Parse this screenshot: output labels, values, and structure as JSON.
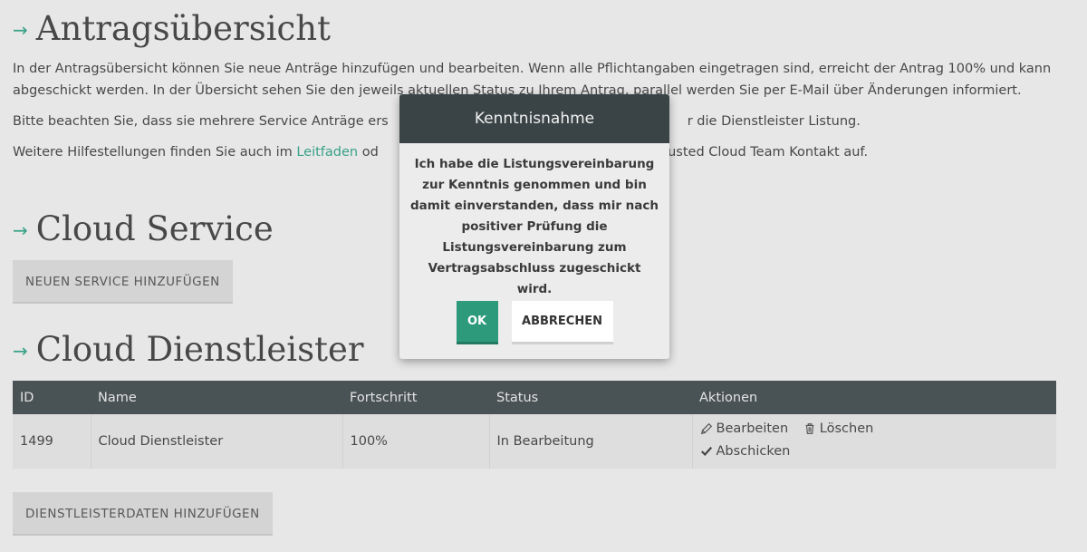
{
  "sections": {
    "overview_title": "Antragsübersicht",
    "cloud_service_title": "Cloud Service",
    "provider_title": "Cloud Dienstleister",
    "arrow": "→"
  },
  "intro": {
    "p1": "In der Antragsübersicht können Sie neue Anträge hinzufügen und bearbeiten. Wenn alle Pflichtangaben eingetragen sind, erreicht der Antrag 100% und kann abgeschickt werden. In der Übersicht sehen Sie den jeweils aktuellen Status zu Ihrem Antrag, parallel werden Sie per E-Mail über Änderungen informiert.",
    "p2_before": "Bitte beachten Sie, dass sie mehrere Service Anträge ers",
    "p2_after": "r die Dienstleister Listung.",
    "p3_before": "Weitere Hilfestellungen finden Sie auch im ",
    "p3_link": "Leitfaden",
    "p3_mid": " od",
    "p3_after": " Trusted Cloud Team Kontakt auf."
  },
  "buttons": {
    "add_service": "NEUEN SERVICE HINZUFÜGEN",
    "add_provider_data": "DIENSTLEISTERDATEN HINZUFÜGEN"
  },
  "table": {
    "headers": {
      "id": "ID",
      "name": "Name",
      "progress": "Fortschritt",
      "status": "Status",
      "actions": "Aktionen"
    },
    "rows": [
      {
        "id": "1499",
        "name": "Cloud Dienstleister",
        "progress": "100%",
        "status": "In Bearbeitung",
        "edit": "Bearbeiten",
        "delete": "Löschen",
        "submit": "Abschicken"
      }
    ]
  },
  "modal": {
    "title": "Kenntnisnahme",
    "body": "Ich habe die Listungsvereinbarung zur Kenntnis genommen und bin damit einverstanden, dass mir nach positiver Prüfung die Listungsvereinbarung zum Vertragsabschluss zugeschickt wird.",
    "ok": "OK",
    "cancel": "ABBRECHEN"
  },
  "colors": {
    "accent": "#3aa58b",
    "ok_button": "#2c9a7b",
    "table_header": "#4b5557",
    "modal_header": "#3a4446"
  },
  "icons": {
    "edit": "pencil-icon",
    "delete": "trash-icon",
    "submit": "check-icon"
  }
}
